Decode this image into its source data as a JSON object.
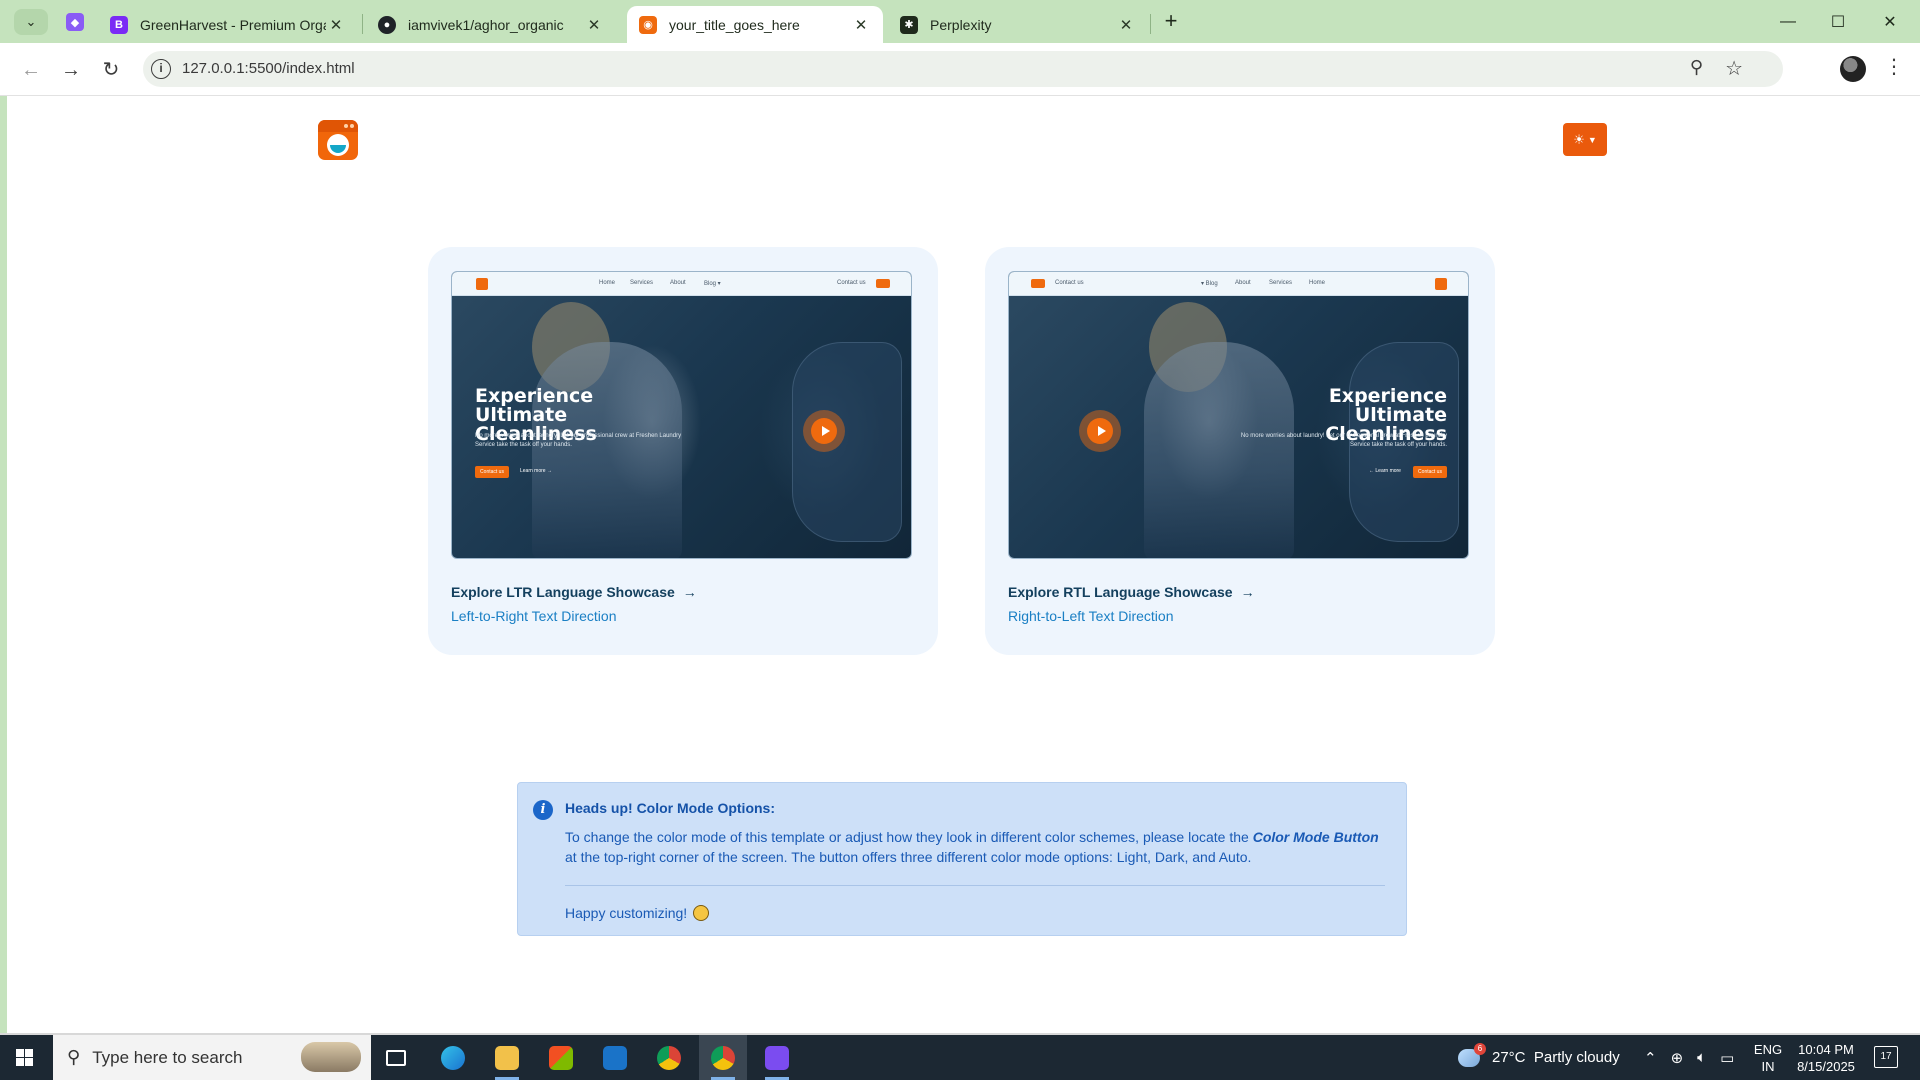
{
  "browser": {
    "tabs": [
      {
        "title": "GreenHarvest - Premium Organ",
        "favicon": "bootstrap-icon",
        "color": "#7a2bf5"
      },
      {
        "title": "iamvivek1/aghor_organic",
        "favicon": "github-icon",
        "color": "#1f2328"
      },
      {
        "title": "your_title_goes_here",
        "favicon": "laundry-logo-icon",
        "color": "#ef6a0e"
      },
      {
        "title": "Perplexity",
        "favicon": "perplexity-icon",
        "color": "#1f2a1c"
      }
    ],
    "url": "127.0.0.1:5500/index.html"
  },
  "page": {
    "accent": "#ea5a0c",
    "cards": [
      {
        "title": "Explore LTR Language Showcase",
        "subtitle": "Left-to-Right Text Direction",
        "preview": {
          "nav": [
            "Home",
            "Services",
            "About",
            "Blog ▾"
          ],
          "contact": "Contact us",
          "headline": "Experience Ultimate Cleanliness",
          "sub": "No more worries about laundry! Let our professional crew at Freshen Laundry Service take the task off your hands.",
          "cta": "Contact us",
          "learn": "Learn more →"
        }
      },
      {
        "title": "Explore RTL Language Showcase",
        "subtitle": "Right-to-Left Text Direction",
        "preview": {
          "nav": [
            "▾ Blog",
            "About",
            "Services",
            "Home"
          ],
          "contact": "Contact us",
          "headline": "Experience Ultimate Cleanliness",
          "sub": "No more worries about laundry! Let our professional crew at Freshen Laundry Service take the task off your hands.",
          "cta": "Contact us",
          "learn": "← Learn more"
        }
      }
    ],
    "alert": {
      "heading": "Heads up! Color Mode Options:",
      "body_before": "To change the color mode of this template or adjust how they look in different color schemes, please locate the ",
      "body_em": "Color Mode Button",
      "body_after": " at the top-right corner of the screen. The button offers three different color mode options: Light, Dark, and Auto.",
      "happy": "Happy customizing!"
    }
  },
  "taskbar": {
    "search_placeholder": "Type here to search",
    "weather": "27°C  Partly cloudy",
    "weather_badge": "6",
    "lang_line1": "ENG",
    "lang_line2": "IN",
    "time": "10:04 PM",
    "date": "8/15/2025",
    "notifications": "17"
  }
}
